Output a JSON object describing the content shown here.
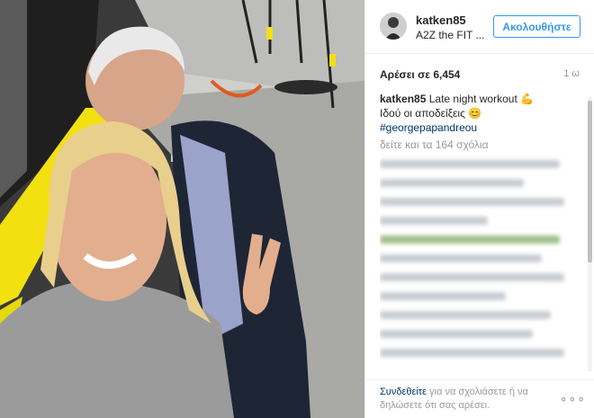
{
  "post": {
    "username": "katken85",
    "location": "A2Z the FIT ...",
    "follow_label": "Ακολουθήστε",
    "likes": "Αρέσει σε 6,454",
    "timestamp": "1 ω"
  },
  "caption": {
    "user": "katken85",
    "text_line1": "Late night workout",
    "text_line2": "Ιδού οι αποδείξεις",
    "hashtag": "#georgepapandreou",
    "view_all": "δείτε και τα 164 σχόλια"
  },
  "footer": {
    "login_link": "Συνδεθείτε",
    "text": " για να σχολιάσετε ή να δηλώσετε ότι σας αρέσει.",
    "more": "∘∘∘"
  },
  "colors": {
    "accent": "#3897f0",
    "link": "#003569",
    "muted": "#999999",
    "floor_yellow": "#f2e011"
  },
  "icons": {
    "flex": "flexed-biceps-emoji",
    "smile": "smiling-face-emoji"
  }
}
